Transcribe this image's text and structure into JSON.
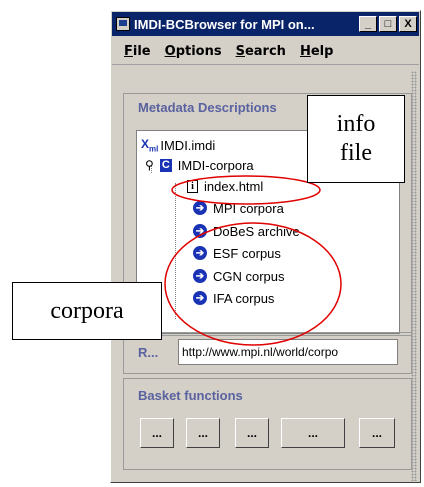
{
  "window": {
    "title": "IMDI-BCBrowser for MPI on...",
    "buttons": {
      "minimize": "_",
      "maximize": "□",
      "close": "X"
    }
  },
  "menu": [
    "File",
    "Options",
    "Search",
    "Help"
  ],
  "metadata_panel": {
    "title": "Metadata Descriptions",
    "tree": {
      "root": {
        "icon_text": "X",
        "icon_sub": "ml",
        "label": "IMDI.imdi"
      },
      "corpus_node": {
        "icon_text": "C",
        "label": "IMDI-corpora"
      },
      "info_file": {
        "icon_text": "i",
        "label": "index.html"
      },
      "children": [
        "MPI corpora",
        "DoBeS archive",
        "ESF corpus",
        "CGN corpus",
        "IFA corpus"
      ]
    }
  },
  "url_panel": {
    "label": "R...",
    "value": "http://www.mpi.nl/world/corpo"
  },
  "basket_panel": {
    "title": "Basket functions",
    "buttons": [
      "...",
      "...",
      "...",
      "...",
      "..."
    ]
  },
  "annotations": {
    "info_callout": "info file",
    "corpora_callout": "corpora"
  },
  "colors": {
    "titlebar": "#0a246a",
    "window_face": "#d4d0c8",
    "panel_title": "#5a62a0",
    "node_icon": "#1a32b4",
    "annotation_ring": "#e00000"
  }
}
